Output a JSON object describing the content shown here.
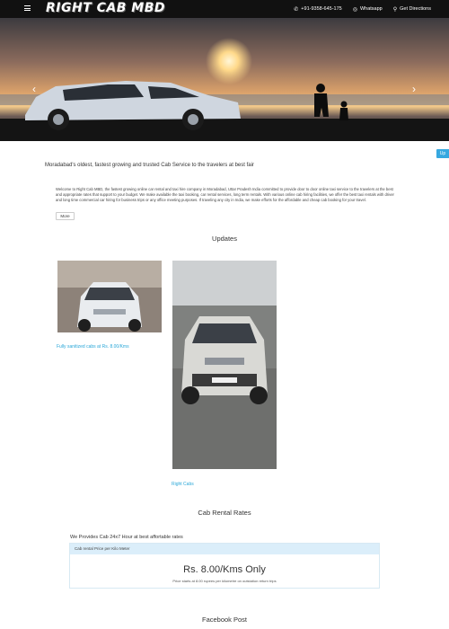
{
  "header": {
    "logo": "RIGHT CAB MBD",
    "phone": "+91-9358-645-175",
    "whatsapp": "Whatsapp",
    "directions": "Get Directions"
  },
  "hero": {
    "prev_arrow": "‹",
    "next_arrow": "›"
  },
  "tagline": "Moradabad's oldest, fastest growing and trusted Cab Service to the travelers at best fair",
  "side_tab": "Up",
  "about": {
    "text": "Welcome to Right Cab MBD, the fastest growing online car rental and taxi hire company in Moradabad, Uttar Pradesh India committed to provide door to door online taxi service to the travelers at the best and appropriate rates that support to your budget. We make available the taxi booking, car rental services, long term rentals. With various online cab hiring facilities, we offer the best taxi rentals with driver and long time commercial car hiring for business trips or any office meeting purposes. If traveling any city in India, we make efforts for the affordable and cheap cab booking for your travel.",
    "more_button": "More"
  },
  "updates": {
    "title": "Updates",
    "items": [
      {
        "caption": "Fully sanitized cabs at Rs. 8.00/Kms"
      },
      {
        "caption": "Right Cabs"
      }
    ]
  },
  "rates": {
    "title": "Cab Rental Rates",
    "intro": "We Provides Cab 24x7 Hour at best affortable rates",
    "header": "Cab rental Price per Kilo Meter",
    "price": "Rs. 8.00/Kms Only",
    "note": "Price starts at 8.00 rupees per kilometre on outstation return trips"
  },
  "facebook": {
    "title": "Facebook Post"
  },
  "icons": {
    "menu": "menu-icon",
    "phone": "phone-icon",
    "whatsapp": "whatsapp-icon",
    "directions": "map-pin-icon"
  }
}
